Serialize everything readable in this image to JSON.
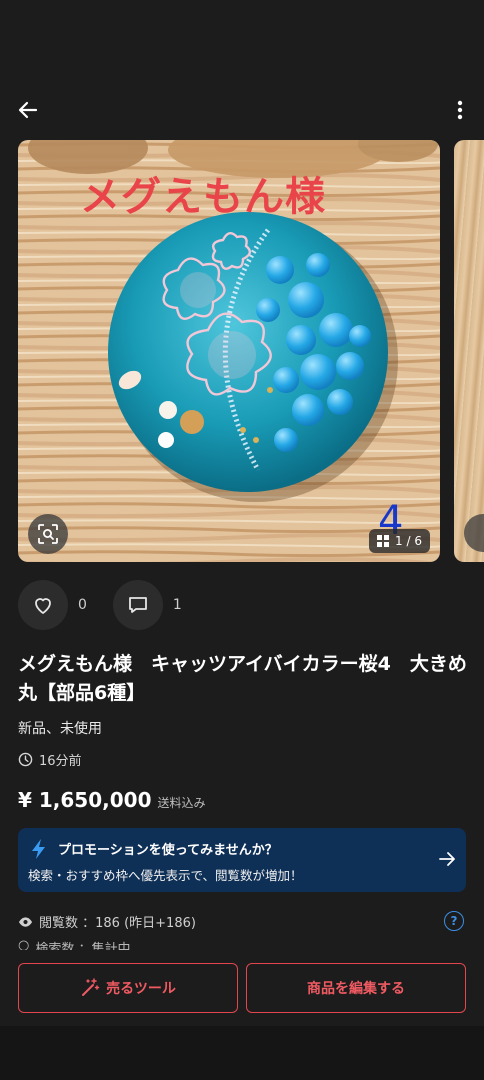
{
  "icons": {
    "back": "arrow-left-icon",
    "more": "more-vertical-icon",
    "scan": "image-search-icon",
    "grid": "grid-icon",
    "like": "heart-icon",
    "comment": "comment-icon",
    "clock": "clock-icon",
    "bolt": "lightning-icon",
    "arrow": "arrow-right-icon",
    "eye": "eye-icon",
    "help": "help-circle-icon",
    "sparkle": "magic-wand-icon"
  },
  "colors": {
    "background": "#1c1c1c",
    "accent": "#e2474f",
    "promo_bg": "#0e2f56",
    "link_blue": "#3b8fe4"
  },
  "gallery": {
    "watermark": "メグえもん様",
    "photo_number": "4",
    "counter": "1 / 6"
  },
  "actions": {
    "like_count": "0",
    "comment_count": "1"
  },
  "item": {
    "title": "メグえもん様　キャッツアイバイカラー桜4　大きめ丸【部品6種】",
    "condition": "新品、未使用",
    "time": "16分前",
    "price": "¥ 1,650,000",
    "price_note": "送料込み"
  },
  "promo": {
    "title": "プロモーションを使ってみませんか？",
    "desc": "検索・おすすめ枠へ優先表示で、閲覧数が増加！"
  },
  "stats": {
    "views": "閲覧数 ：186 (昨日+186)",
    "search_partial": "検索数 ：集計中",
    "help": "?"
  },
  "buttons": {
    "sell_tools": "売るツール",
    "edit_item": "商品を編集する"
  }
}
